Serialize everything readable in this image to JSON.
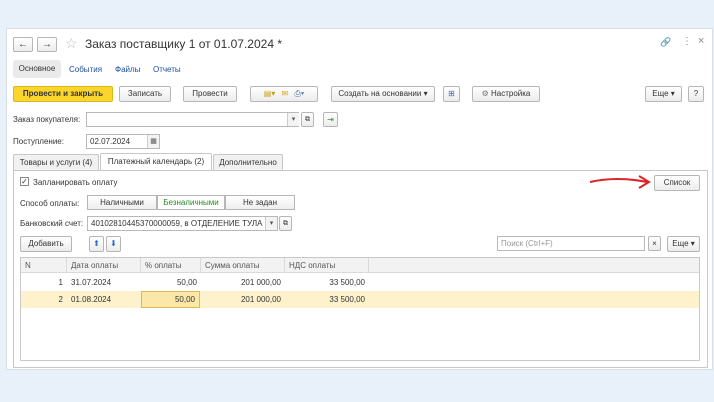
{
  "window": {
    "title": "Заказ поставщику 1 от 01.07.2024 *",
    "nav_tabs": [
      "Основное",
      "События",
      "Файлы",
      "Отчеты"
    ]
  },
  "toolbar": {
    "post_close": "Провести и закрыть",
    "save": "Записать",
    "post": "Провести",
    "create_based": "Создать на основании",
    "settings": "Настройка",
    "more": "Еще",
    "help": "?"
  },
  "form": {
    "buyer_order_label": "Заказ покупателя:",
    "buyer_order_value": "",
    "receipt_label": "Поступление:",
    "receipt_value": "02.07.2024"
  },
  "tabs": [
    "Товары и услуги (4)",
    "Платежный календарь (2)",
    "Дополнительно"
  ],
  "payment": {
    "plan_label": "Запланировать оплату",
    "list_button": "Список",
    "method_label": "Способ оплаты:",
    "methods": [
      "Наличными",
      "Безналичными",
      "Не задан"
    ],
    "bank_label": "Банковский счет:",
    "bank_value": "40102810445370000059, в ОТДЕЛЕНИЕ ТУЛА"
  },
  "table_toolbar": {
    "add": "Добавить",
    "search_placeholder": "Поиск (Ctrl+F)",
    "more": "Еще"
  },
  "table": {
    "headers": [
      "N",
      "Дата оплаты",
      "% оплаты",
      "Сумма оплаты",
      "НДС оплаты"
    ],
    "rows": [
      [
        "1",
        "31.07.2024",
        "50,00",
        "201 000,00",
        "33 500,00"
      ],
      [
        "2",
        "01.08.2024",
        "50,00",
        "201 000,00",
        "33 500,00"
      ]
    ]
  },
  "colors": {
    "accent_button": "#fbd52c",
    "selected_row": "#fdf2cc",
    "arrow": "#d9252a"
  }
}
